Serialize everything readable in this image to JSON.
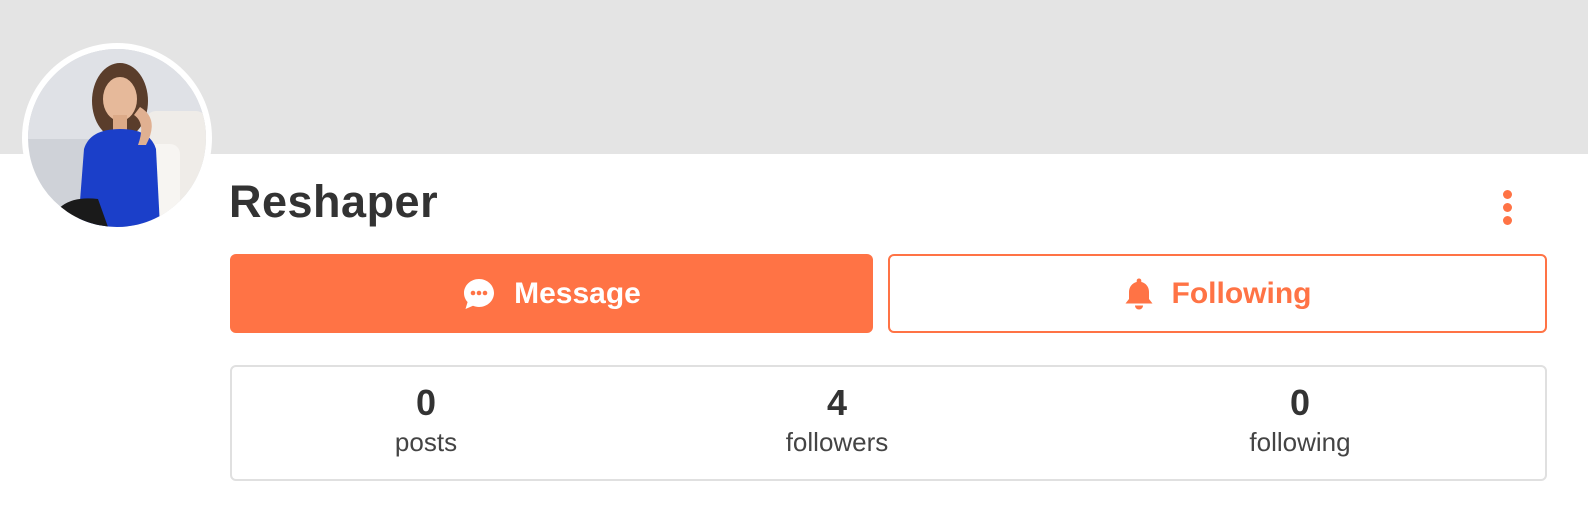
{
  "profile": {
    "name": "Reshaper",
    "avatar_alt": "profile photo"
  },
  "actions": {
    "message_label": "Message",
    "following_label": "Following",
    "message_icon": "chat-bubble-icon",
    "following_icon": "bell-icon",
    "more_icon": "more-vertical-icon"
  },
  "stats": [
    {
      "value": "0",
      "label": "posts"
    },
    {
      "value": "4",
      "label": "followers"
    },
    {
      "value": "0",
      "label": "following"
    }
  ],
  "colors": {
    "accent": "#ff7345",
    "cover": "#e4e4e4",
    "text": "#333333"
  }
}
